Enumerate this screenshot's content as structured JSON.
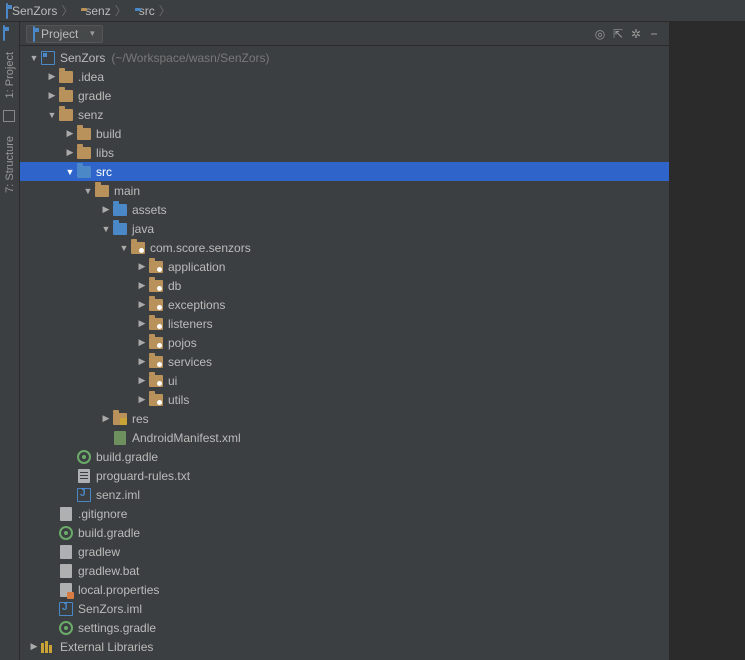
{
  "breadcrumb": [
    {
      "label": "SenZors",
      "icon": "module"
    },
    {
      "label": "senz",
      "icon": "folder"
    },
    {
      "label": "src",
      "icon": "folder-src"
    }
  ],
  "panel": {
    "title": "Project",
    "tools": [
      "target-icon",
      "collapse-icon",
      "settings-icon",
      "hide-icon"
    ]
  },
  "gutter": [
    {
      "label": "1: Project",
      "icon": "project"
    },
    {
      "label": "7: Structure",
      "icon": "structure"
    }
  ],
  "tree": [
    {
      "d": 0,
      "exp": "open",
      "icon": "module",
      "label": "SenZors",
      "muted": "(~/Workspace/wasn/SenZors)"
    },
    {
      "d": 1,
      "exp": "closed",
      "icon": "folder",
      "label": ".idea"
    },
    {
      "d": 1,
      "exp": "closed",
      "icon": "folder",
      "label": "gradle"
    },
    {
      "d": 1,
      "exp": "open",
      "icon": "folder",
      "label": "senz"
    },
    {
      "d": 2,
      "exp": "closed",
      "icon": "folder",
      "label": "build"
    },
    {
      "d": 2,
      "exp": "closed",
      "icon": "folder",
      "label": "libs"
    },
    {
      "d": 2,
      "exp": "open",
      "icon": "folder-src",
      "label": "src",
      "selected": true
    },
    {
      "d": 3,
      "exp": "open",
      "icon": "folder",
      "label": "main"
    },
    {
      "d": 4,
      "exp": "closed",
      "icon": "folder-src",
      "label": "assets"
    },
    {
      "d": 4,
      "exp": "open",
      "icon": "folder-src",
      "label": "java"
    },
    {
      "d": 5,
      "exp": "open",
      "icon": "folder-pkg",
      "label": "com.score.senzors"
    },
    {
      "d": 6,
      "exp": "closed",
      "icon": "folder-pkg",
      "label": "application"
    },
    {
      "d": 6,
      "exp": "closed",
      "icon": "folder-pkg",
      "label": "db"
    },
    {
      "d": 6,
      "exp": "closed",
      "icon": "folder-pkg",
      "label": "exceptions"
    },
    {
      "d": 6,
      "exp": "closed",
      "icon": "folder-pkg",
      "label": "listeners"
    },
    {
      "d": 6,
      "exp": "closed",
      "icon": "folder-pkg",
      "label": "pojos"
    },
    {
      "d": 6,
      "exp": "closed",
      "icon": "folder-pkg",
      "label": "services"
    },
    {
      "d": 6,
      "exp": "closed",
      "icon": "folder-pkg",
      "label": "ui"
    },
    {
      "d": 6,
      "exp": "closed",
      "icon": "folder-pkg",
      "label": "utils"
    },
    {
      "d": 4,
      "exp": "closed",
      "icon": "folder-res",
      "label": "res"
    },
    {
      "d": 4,
      "exp": "none",
      "icon": "file-xml",
      "label": "AndroidManifest.xml"
    },
    {
      "d": 2,
      "exp": "none",
      "icon": "file-gradle",
      "label": "build.gradle"
    },
    {
      "d": 2,
      "exp": "none",
      "icon": "file-txt",
      "label": "proguard-rules.txt"
    },
    {
      "d": 2,
      "exp": "none",
      "icon": "file-iml",
      "label": "senz.iml"
    },
    {
      "d": 1,
      "exp": "none",
      "icon": "file",
      "label": ".gitignore"
    },
    {
      "d": 1,
      "exp": "none",
      "icon": "file-gradle",
      "label": "build.gradle"
    },
    {
      "d": 1,
      "exp": "none",
      "icon": "file",
      "label": "gradlew"
    },
    {
      "d": 1,
      "exp": "none",
      "icon": "file",
      "label": "gradlew.bat"
    },
    {
      "d": 1,
      "exp": "none",
      "icon": "file-prop",
      "label": "local.properties"
    },
    {
      "d": 1,
      "exp": "none",
      "icon": "file-iml",
      "label": "SenZors.iml"
    },
    {
      "d": 1,
      "exp": "none",
      "icon": "file-gradle",
      "label": "settings.gradle"
    },
    {
      "d": 0,
      "exp": "closed",
      "icon": "libs",
      "label": "External Libraries"
    }
  ]
}
